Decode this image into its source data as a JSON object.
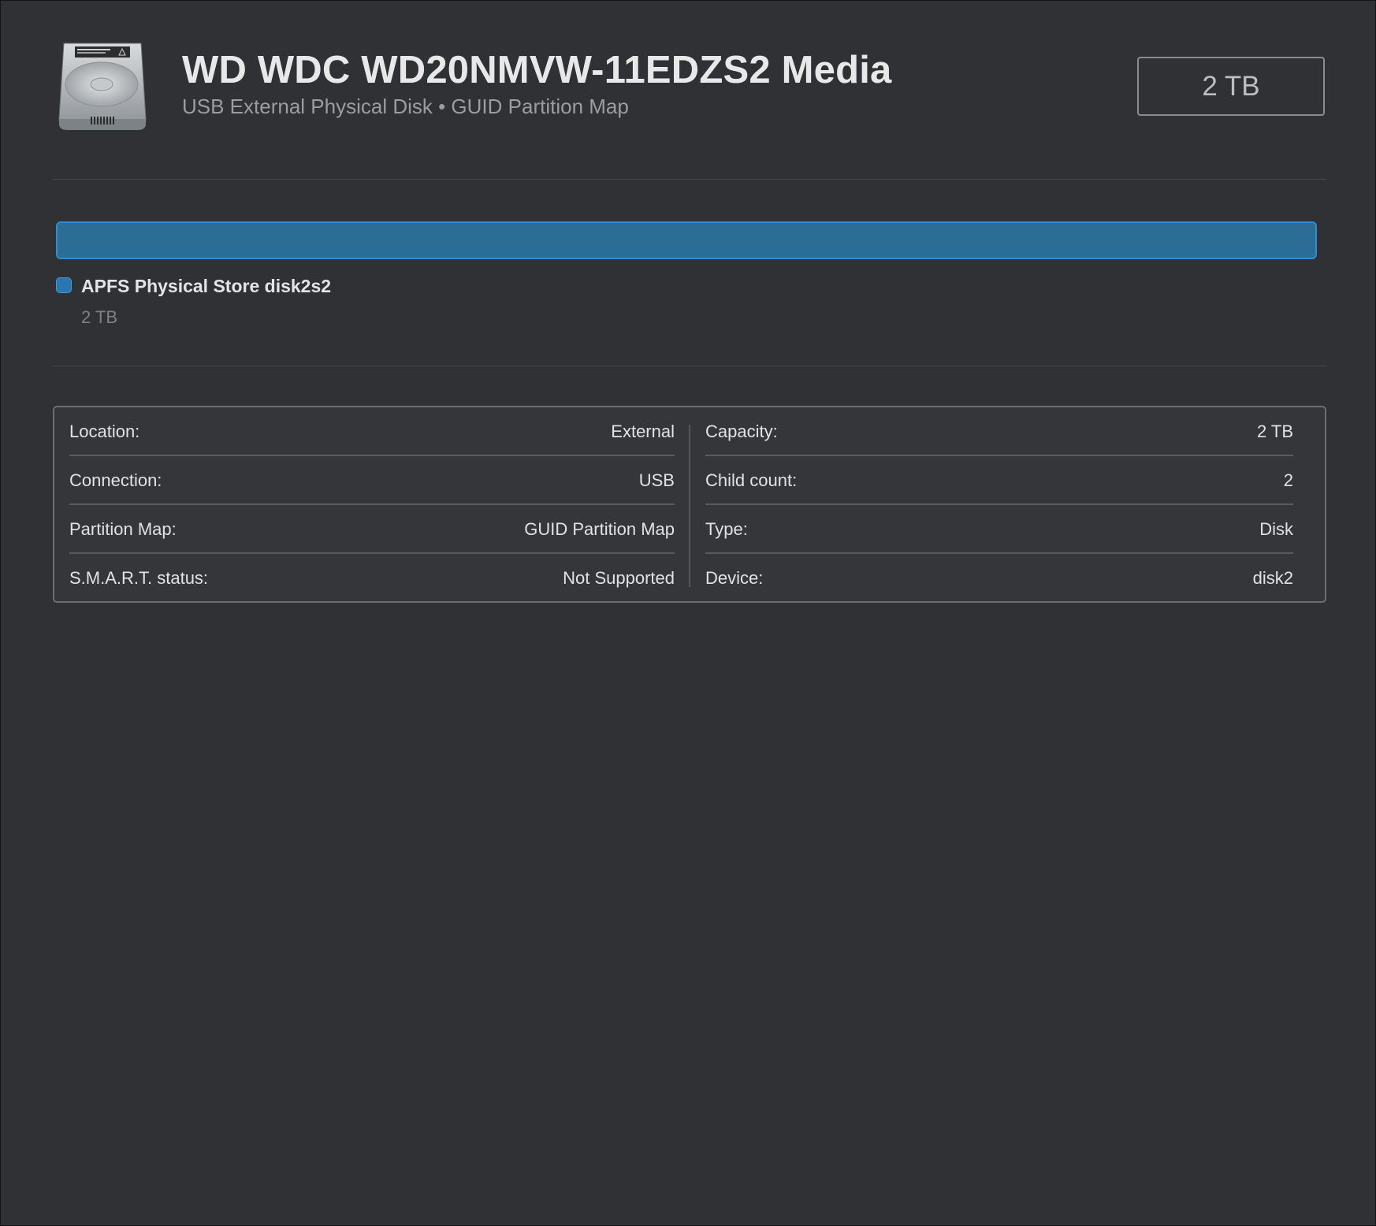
{
  "header": {
    "title": "WD WDC WD20NMVW-11EDZS2 Media",
    "subtitle": "USB External Physical Disk • GUID Partition Map",
    "capacity": "2 TB",
    "icon": "external-hard-drive-icon"
  },
  "partition": {
    "bar_color": "#2b6d94",
    "name": "APFS Physical Store disk2s2",
    "size": "2 TB"
  },
  "info": {
    "left": [
      {
        "label": "Location:",
        "value": "External"
      },
      {
        "label": "Connection:",
        "value": "USB"
      },
      {
        "label": "Partition Map:",
        "value": "GUID Partition Map"
      },
      {
        "label": "S.M.A.R.T. status:",
        "value": "Not Supported"
      }
    ],
    "right": [
      {
        "label": "Capacity:",
        "value": "2 TB"
      },
      {
        "label": "Child count:",
        "value": "2"
      },
      {
        "label": "Type:",
        "value": "Disk"
      },
      {
        "label": "Device:",
        "value": "disk2"
      }
    ]
  }
}
